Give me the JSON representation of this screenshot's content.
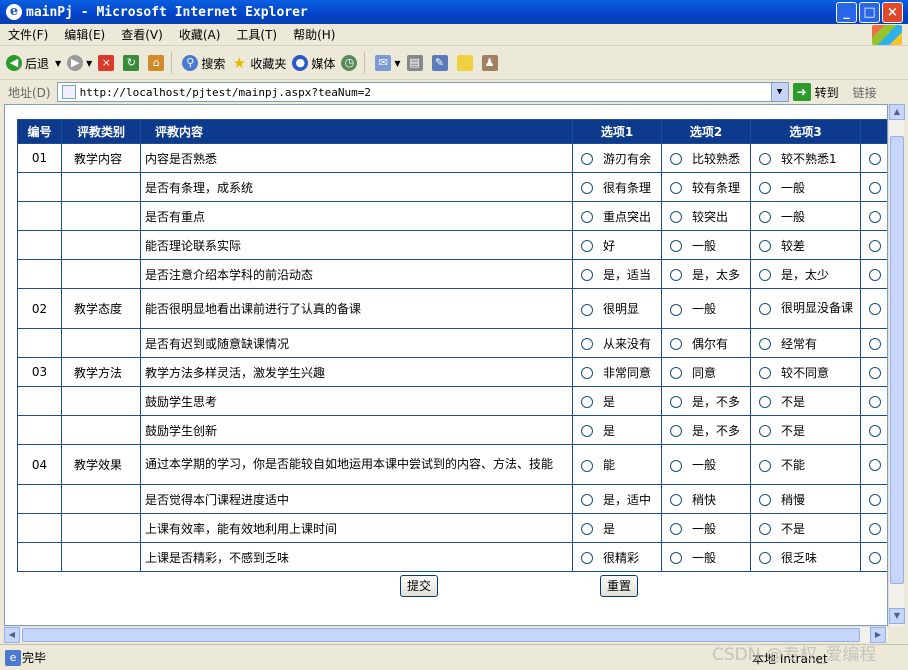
{
  "window": {
    "title": "mainPj - Microsoft Internet Explorer"
  },
  "menu": [
    "文件(F)",
    "编辑(E)",
    "查看(V)",
    "收藏(A)",
    "工具(T)",
    "帮助(H)"
  ],
  "toolbar": {
    "back": "后退",
    "search": "搜索",
    "favorites": "收藏夹",
    "media": "媒体"
  },
  "address": {
    "label": "地址(D)",
    "url": "http://localhost/pjtest/mainpj.aspx?teaNum=2",
    "go": "转到",
    "links": "链接"
  },
  "table": {
    "headers": [
      "编号",
      "评教类别",
      "评教内容",
      "选项1",
      "选项2",
      "选项3"
    ],
    "rows": [
      {
        "num": "01",
        "cat": "教学内容",
        "q": "内容是否熟悉",
        "o1": "游刃有余",
        "o2": "比较熟悉",
        "o3": "较不熟悉1"
      },
      {
        "num": "",
        "cat": "",
        "q": "是否有条理，成系统",
        "o1": "很有条理",
        "o2": "较有条理",
        "o3": "一般"
      },
      {
        "num": "",
        "cat": "",
        "q": "是否有重点",
        "o1": "重点突出",
        "o2": "较突出",
        "o3": "一般"
      },
      {
        "num": "",
        "cat": "",
        "q": "能否理论联系实际",
        "o1": "好",
        "o2": "一般",
        "o3": "较差"
      },
      {
        "num": "",
        "cat": "",
        "q": "是否注意介绍本学科的前沿动态",
        "o1": "是，适当",
        "o2": "是，太多",
        "o3": "是，太少"
      },
      {
        "num": "02",
        "cat": "教学态度",
        "q": "能否很明显地看出课前进行了认真的备课",
        "o1": "很明显",
        "o2": "一般",
        "o3": "很明显没备课"
      },
      {
        "num": "",
        "cat": "",
        "q": "是否有迟到或随意缺课情况",
        "o1": "从来没有",
        "o2": "偶尔有",
        "o3": "经常有"
      },
      {
        "num": "03",
        "cat": "教学方法",
        "q": "教学方法多样灵活，激发学生兴趣",
        "o1": "非常同意",
        "o2": "同意",
        "o3": "较不同意"
      },
      {
        "num": "",
        "cat": "",
        "q": "鼓励学生思考",
        "o1": "是",
        "o2": "是，不多",
        "o3": "不是"
      },
      {
        "num": "",
        "cat": "",
        "q": "鼓励学生创新",
        "o1": "是",
        "o2": "是，不多",
        "o3": "不是"
      },
      {
        "num": "04",
        "cat": "教学效果",
        "q": "通过本学期的学习，你是否能较自如地运用本课中尝试到的内容、方法、技能",
        "o1": "能",
        "o2": "一般",
        "o3": "不能"
      },
      {
        "num": "",
        "cat": "",
        "q": "是否觉得本门课程进度适中",
        "o1": "是，适中",
        "o2": "稍快",
        "o3": "稍慢"
      },
      {
        "num": "",
        "cat": "",
        "q": "上课有效率，能有效地利用上课时间",
        "o1": "是",
        "o2": "一般",
        "o3": "不是"
      },
      {
        "num": "",
        "cat": "",
        "q": "上课是否精彩，不感到乏味",
        "o1": "很精彩",
        "o2": "一般",
        "o3": "很乏味"
      }
    ]
  },
  "buttons": {
    "submit": "提交",
    "reset": "重置"
  },
  "status": {
    "text": "完毕",
    "zone": "本地 Intranet"
  },
  "watermark": "CSDN @专权_爱编程"
}
